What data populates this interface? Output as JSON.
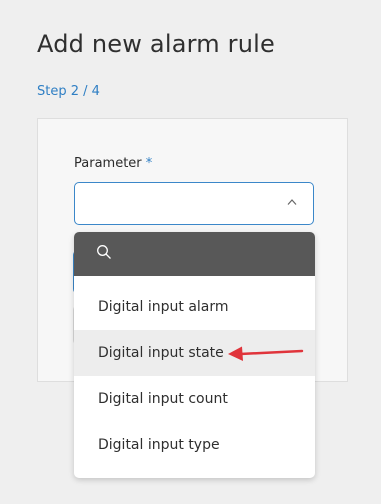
{
  "page": {
    "title": "Add new alarm rule",
    "step": "Step 2 / 4"
  },
  "form": {
    "parameter_label": "Parameter",
    "required_marker": "*",
    "parameter_value": ""
  },
  "dropdown": {
    "search_placeholder": "",
    "options": [
      {
        "label": "Digital input alarm"
      },
      {
        "label": "Digital input state"
      },
      {
        "label": "Digital input count"
      },
      {
        "label": "Digital input type"
      }
    ],
    "highlighted_index": 1
  },
  "icons": {
    "search": "search-icon",
    "chevron": "chevron-up-icon",
    "annotation": "red-arrow-icon"
  },
  "colors": {
    "accent": "#2f7fc4",
    "annotation": "#e0343b",
    "search_bar": "#585858"
  }
}
